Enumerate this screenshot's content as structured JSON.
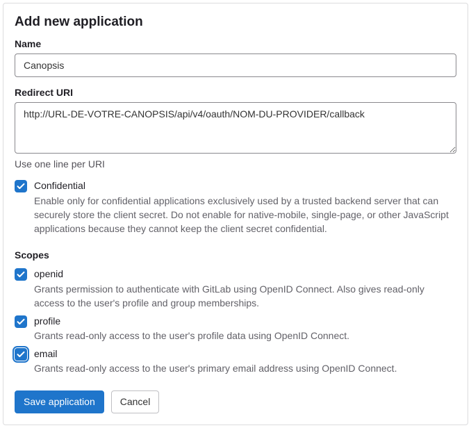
{
  "title": "Add new application",
  "name": {
    "label": "Name",
    "value": "Canopsis"
  },
  "redirect": {
    "label": "Redirect URI",
    "value": "http://URL-DE-VOTRE-CANOPSIS/api/v4/oauth/NOM-DU-PROVIDER/callback",
    "help": "Use one line per URI"
  },
  "confidential": {
    "label": "Confidential",
    "checked": true,
    "desc": "Enable only for confidential applications exclusively used by a trusted backend server that can securely store the client secret. Do not enable for native-mobile, single-page, or other JavaScript applications because they cannot keep the client secret confidential."
  },
  "scopes": {
    "label": "Scopes",
    "items": [
      {
        "name": "openid",
        "checked": true,
        "focused": false,
        "desc": "Grants permission to authenticate with GitLab using OpenID Connect. Also gives read-only access to the user's profile and group memberships."
      },
      {
        "name": "profile",
        "checked": true,
        "focused": false,
        "desc": "Grants read-only access to the user's profile data using OpenID Connect."
      },
      {
        "name": "email",
        "checked": true,
        "focused": true,
        "desc": "Grants read-only access to the user's primary email address using OpenID Connect."
      }
    ]
  },
  "actions": {
    "save": "Save application",
    "cancel": "Cancel"
  }
}
